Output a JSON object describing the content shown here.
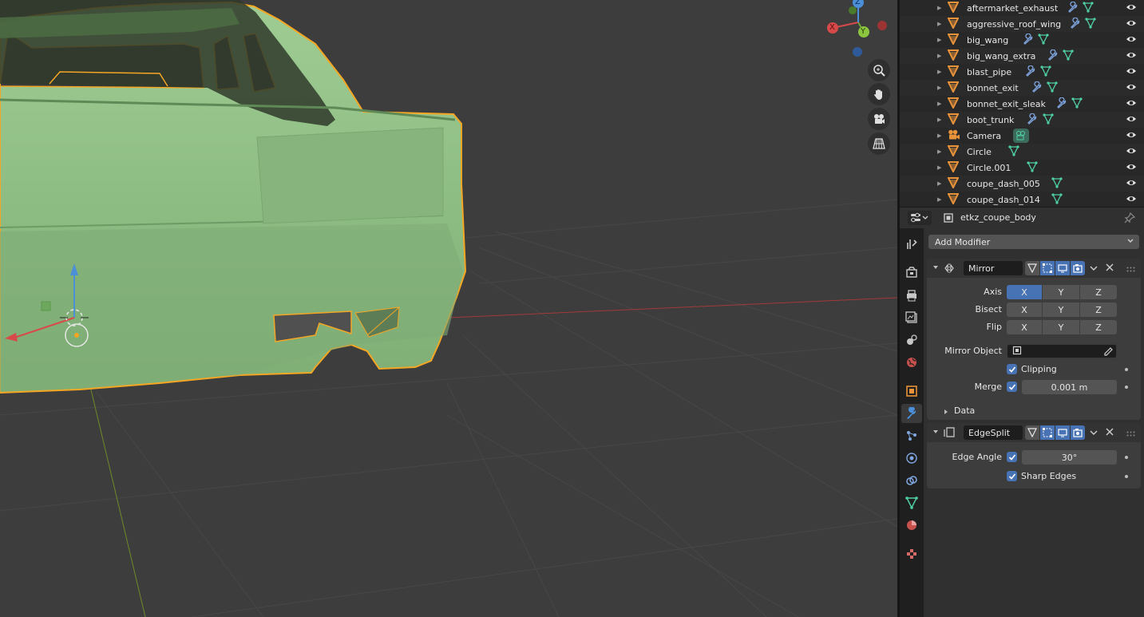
{
  "outliner": {
    "items": [
      {
        "name": "aftermarket_exhaust",
        "type": "mesh"
      },
      {
        "name": "aggressive_roof_wing",
        "type": "mesh"
      },
      {
        "name": "big_wang",
        "type": "mesh"
      },
      {
        "name": "big_wang_extra",
        "type": "mesh"
      },
      {
        "name": "blast_pipe",
        "type": "mesh"
      },
      {
        "name": "bonnet_exit",
        "type": "mesh"
      },
      {
        "name": "bonnet_exit_sleak",
        "type": "mesh"
      },
      {
        "name": "boot_trunk",
        "type": "mesh"
      },
      {
        "name": "Camera",
        "type": "camera"
      },
      {
        "name": "Circle",
        "type": "mesh"
      },
      {
        "name": "Circle.001",
        "type": "mesh"
      },
      {
        "name": "coupe_dash_005",
        "type": "mesh"
      },
      {
        "name": "coupe_dash_014",
        "type": "mesh"
      }
    ]
  },
  "properties": {
    "object_name": "etkz_coupe_body",
    "add_modifier_label": "Add Modifier",
    "mirror": {
      "name": "Mirror",
      "axis_label": "Axis",
      "bisect_label": "Bisect",
      "flip_label": "Flip",
      "axes": [
        "X",
        "Y",
        "Z"
      ],
      "mirror_object_label": "Mirror Object",
      "clipping_label": "Clipping",
      "merge_label": "Merge",
      "merge_value": "0.001 m",
      "data_label": "Data"
    },
    "edgesplit": {
      "name": "EdgeSplit",
      "edge_angle_label": "Edge Angle",
      "edge_angle_value": "30°",
      "sharp_edges_label": "Sharp Edges"
    }
  },
  "gizmo": {
    "x": "X",
    "y": "Y",
    "z": "Z"
  },
  "colors": {
    "selection_outline": "#f5a623",
    "mesh_green": "#8fbf85",
    "accent_blue": "#4772b3",
    "mesh_icon_orange": "#e8923a",
    "wrench_blue": "#7fa6e0",
    "vertex_green": "#4fd0a3"
  }
}
